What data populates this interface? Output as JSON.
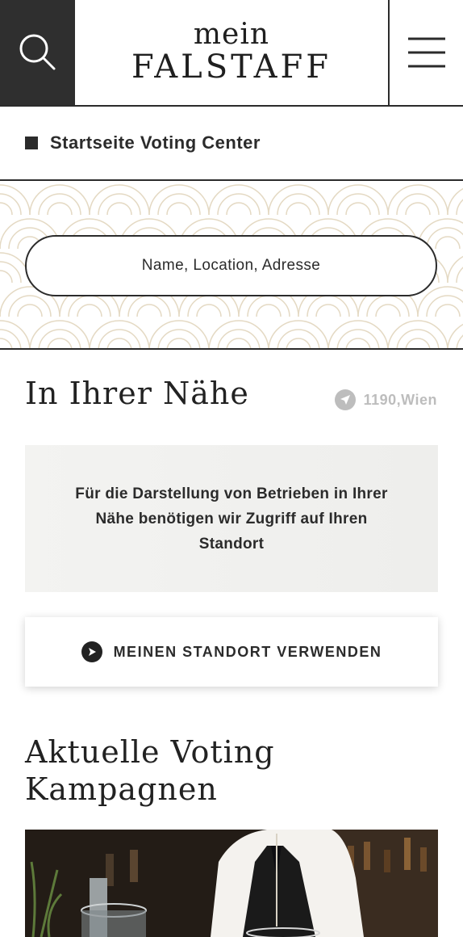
{
  "header": {
    "logo_line1": "mein",
    "logo_line2": "FALSTAFF",
    "search_icon": "search-icon",
    "menu_icon": "hamburger-menu-icon"
  },
  "breadcrumb": {
    "label": "Startseite Voting Center"
  },
  "search": {
    "placeholder": "Name, Location, Adresse"
  },
  "nearby": {
    "title": "In Ihrer Nähe",
    "location_label": "1190,Wien",
    "info_text": "Für die Darstellung von Betrieben in Ihrer Nähe benötigen wir Zugriff auf Ihren Standort",
    "use_location_label": "MEINEN STANDORT VERWENDEN"
  },
  "campaigns": {
    "title": "Aktuelle Voting Kampagnen"
  },
  "colors": {
    "dark": "#2f2f2f",
    "pattern": "#e4d9c3",
    "muted": "#bdbdbd",
    "box": "#f2f2f0"
  }
}
